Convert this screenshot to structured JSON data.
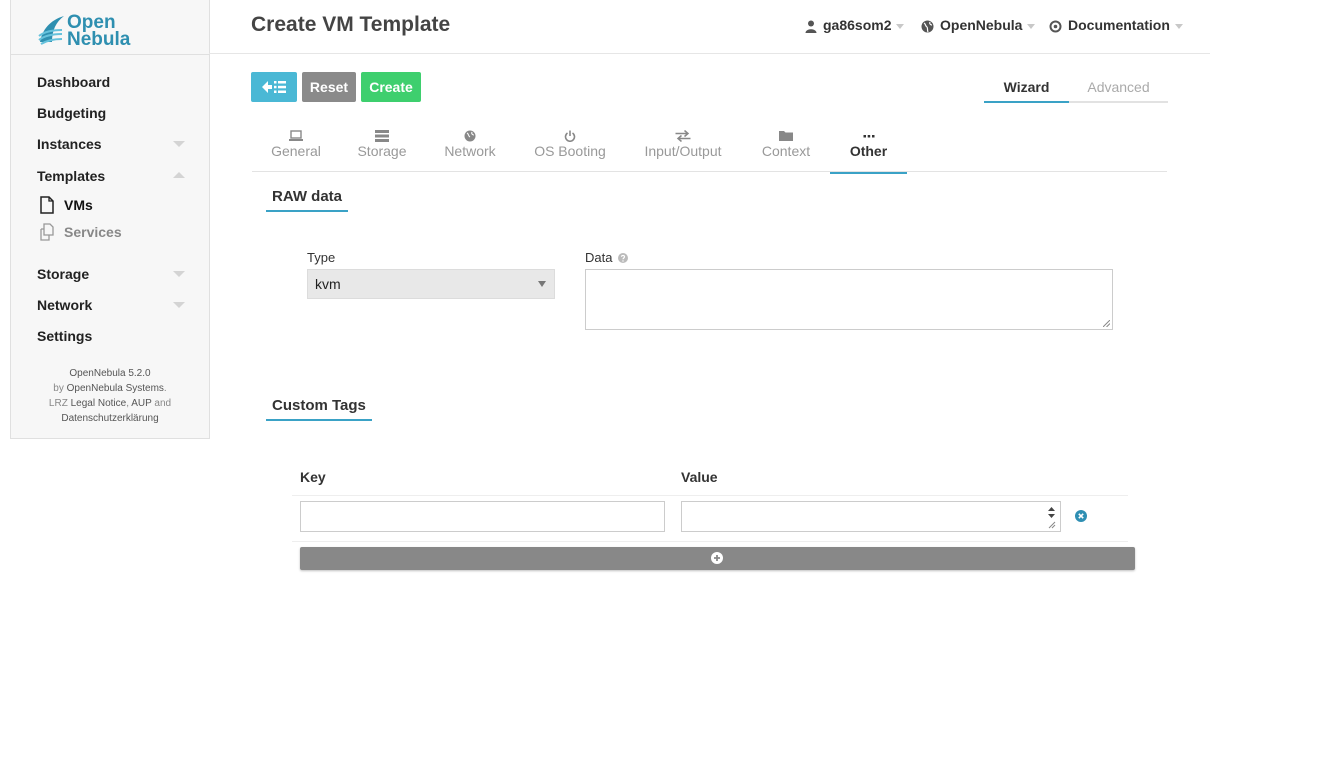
{
  "logo": {
    "line1": "Open",
    "line2": "Nebula"
  },
  "sidebar": {
    "items": [
      {
        "label": "Dashboard"
      },
      {
        "label": "Budgeting"
      },
      {
        "label": "Instances"
      },
      {
        "label": "Templates"
      },
      {
        "label": "Storage"
      },
      {
        "label": "Network"
      },
      {
        "label": "Settings"
      }
    ],
    "subitems": [
      {
        "label": "VMs",
        "icon": "file-icon"
      },
      {
        "label": "Services",
        "icon": "copy-icon"
      }
    ],
    "footer": {
      "version": "OpenNebula 5.2.0",
      "by": "by",
      "company": "OpenNebula Systems",
      "lrz": "LRZ",
      "legal": "Legal Notice",
      "aup": "AUP",
      "and": "and",
      "privacy": "Datenschutzerklärung"
    }
  },
  "header": {
    "title": "Create VM Template",
    "user": "ga86som2",
    "zone": "OpenNebula",
    "docs": "Documentation"
  },
  "toolbar": {
    "reset_label": "Reset",
    "create_label": "Create"
  },
  "mode_tabs": {
    "wizard": "Wizard",
    "advanced": "Advanced"
  },
  "wizard_tabs": [
    {
      "label": "General",
      "icon": "laptop-icon"
    },
    {
      "label": "Storage",
      "icon": "server-icon"
    },
    {
      "label": "Network",
      "icon": "globe-icon"
    },
    {
      "label": "OS Booting",
      "icon": "power-icon"
    },
    {
      "label": "Input/Output",
      "icon": "exchange-icon"
    },
    {
      "label": "Context",
      "icon": "folder-icon"
    },
    {
      "label": "Other",
      "icon": "ellipsis-icon",
      "active": true
    }
  ],
  "raw": {
    "title": "RAW data",
    "type_label": "Type",
    "type_value": "kvm",
    "data_label": "Data",
    "data_value": ""
  },
  "custom_tags": {
    "title": "Custom Tags",
    "key_header": "Key",
    "value_header": "Value",
    "rows": [
      {
        "key": "",
        "value": ""
      }
    ]
  },
  "colors": {
    "accent": "#3aa2c6",
    "back_button": "#4ab8d5",
    "reset_button": "#8a8a8a",
    "create_button": "#3ecf6e"
  }
}
